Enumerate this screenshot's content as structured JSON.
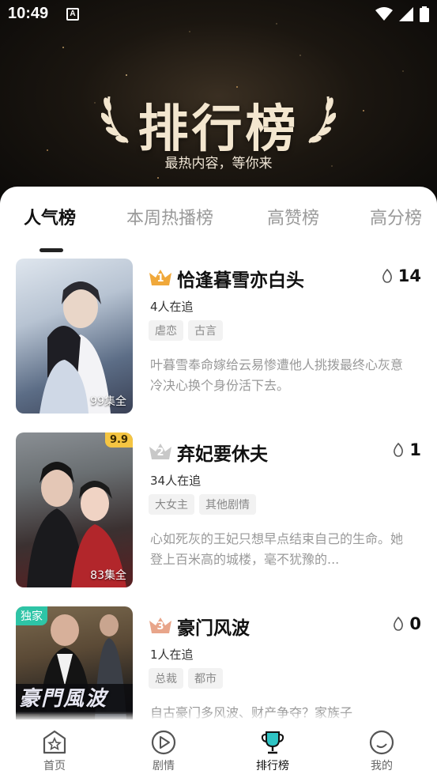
{
  "status": {
    "time": "10:49",
    "a_badge": "A"
  },
  "hero": {
    "title": "排行榜",
    "subtitle": "最热内容，等你来"
  },
  "tabs": [
    {
      "label": "人气榜",
      "active": true
    },
    {
      "label": "本周热播榜",
      "active": false
    },
    {
      "label": "高赞榜",
      "active": false
    },
    {
      "label": "高分榜",
      "active": false
    }
  ],
  "items": [
    {
      "rank": "1",
      "rank_color": "#f0a83a",
      "title": "恰逢暮雪亦白头",
      "heat": "14",
      "followers": "4人在追",
      "tags": [
        "虐恋",
        "古言"
      ],
      "desc": "叶暮雪奉命嫁给云易惨遭他人挑拨最终心灰意冷决心换个身份活下去。",
      "poster_episodes": "99集全",
      "poster_tag": "",
      "poster_score": ""
    },
    {
      "rank": "2",
      "rank_color": "#c8c8c8",
      "title": "弃妃要休夫",
      "heat": "1",
      "followers": "34人在追",
      "tags": [
        "大女主",
        "其他剧情"
      ],
      "desc": "心如死灰的王妃只想早点结束自己的生命。她登上百米高的城楼，毫不犹豫的...",
      "poster_episodes": "83集全",
      "poster_tag": "",
      "poster_score": "9.9"
    },
    {
      "rank": "3",
      "rank_color": "#e8a58a",
      "title": "豪门风波",
      "heat": "0",
      "followers": "1人在追",
      "tags": [
        "总裁",
        "都市"
      ],
      "desc": "自古豪门多风波、财产争夺？家族子",
      "poster_episodes": "",
      "poster_tag": "独家",
      "poster_score": "",
      "poster_overlay": "豪門風波"
    }
  ],
  "nav": [
    {
      "label": "首页",
      "icon": "home-star-icon",
      "active": false
    },
    {
      "label": "剧情",
      "icon": "play-circle-icon",
      "active": false
    },
    {
      "label": "排行榜",
      "icon": "trophy-icon",
      "active": true
    },
    {
      "label": "我的",
      "icon": "profile-circle-icon",
      "active": false
    }
  ],
  "colors": {
    "accent_dark": "#111111",
    "muted": "#999999",
    "trophy": "#2ec4c4"
  }
}
